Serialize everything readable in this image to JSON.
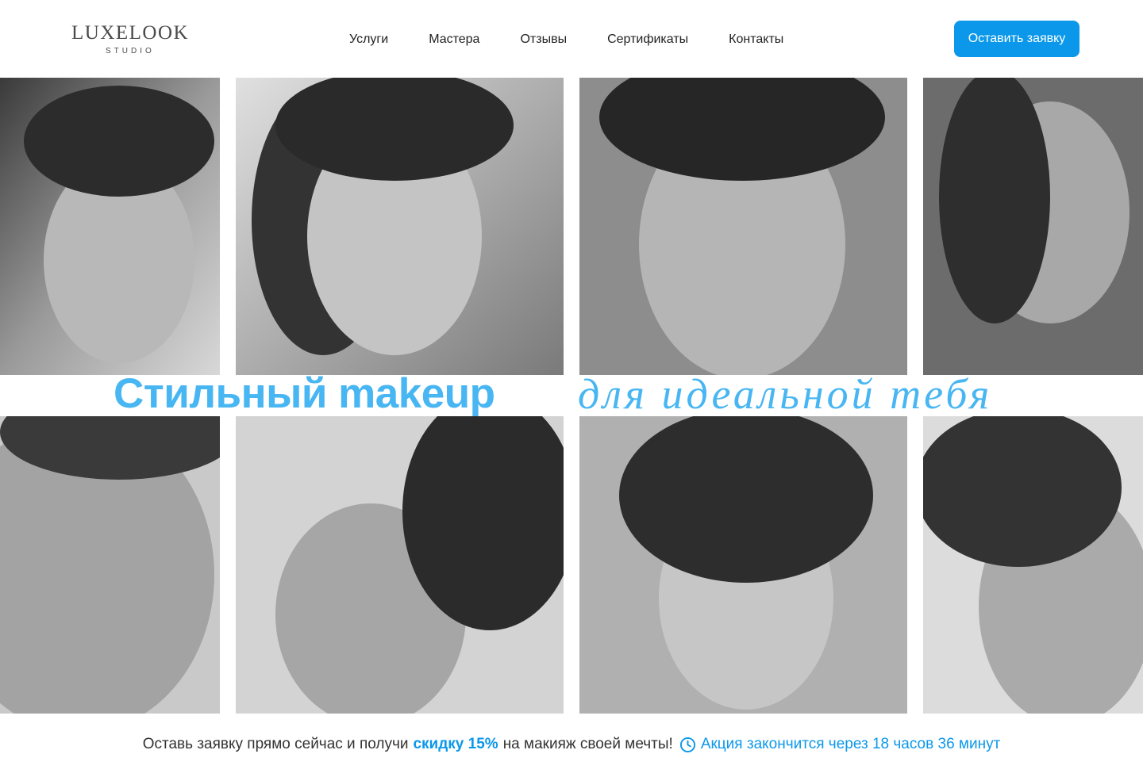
{
  "brand": {
    "name": "LUXELOOK",
    "sub": "STUDIO"
  },
  "nav": {
    "items": [
      {
        "label": "Услуги"
      },
      {
        "label": "Мастера"
      },
      {
        "label": "Отзывы"
      },
      {
        "label": "Сертификаты"
      },
      {
        "label": "Контакты"
      }
    ]
  },
  "cta": {
    "label": "Оставить заявку"
  },
  "hero": {
    "headline_bold": "Стильный makeup",
    "headline_script": "для идеальной тебя"
  },
  "promo": {
    "text_before": "Оставь заявку прямо сейчас и получи",
    "highlight": "скидку 15%",
    "text_after": "на макияж своей мечты!",
    "timer_icon": "clock-icon",
    "timer": "Акция закончится через 18 часов 36 минут"
  },
  "colors": {
    "accent": "#0b98ea",
    "headline": "#48b6f2",
    "photo_tint": "#8f8f8f"
  }
}
